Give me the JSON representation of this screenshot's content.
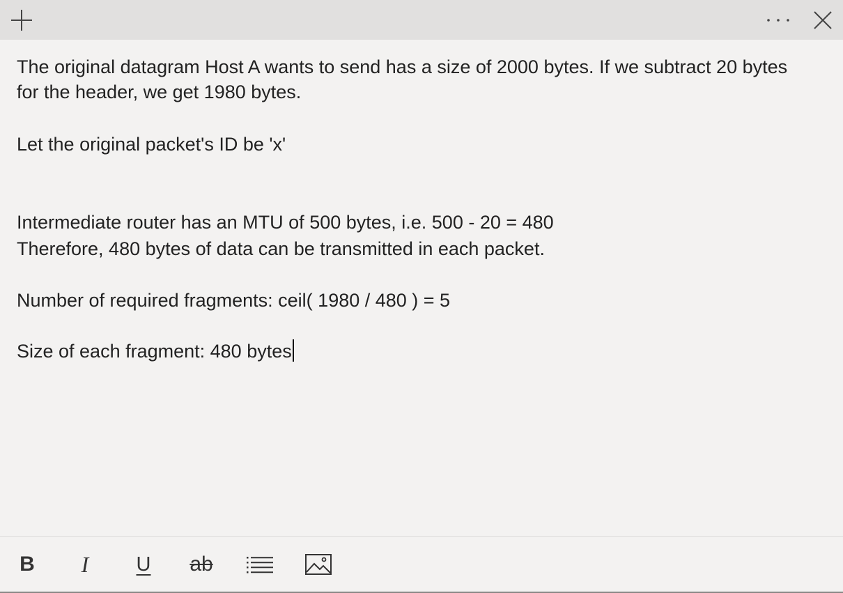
{
  "titlebar": {
    "icons": {
      "add": "plus-icon",
      "more": "more-horizontal-icon",
      "close": "close-icon"
    }
  },
  "note": {
    "lines": [
      "The original datagram Host A wants to send has a size of 2000 bytes. If we subtract 20 bytes",
      "for the header, we get 1980 bytes.",
      "Let the original packet's ID be 'x'",
      "Intermediate router has an MTU of 500 bytes, i.e. 500 - 20 = 480",
      "Therefore, 480 bytes of data can be transmitted in each packet.",
      "Number of required fragments:  ceil( 1980 / 480 ) = 5",
      "Size of each fragment: 480 bytes"
    ]
  },
  "toolbar": {
    "bold_label": "B",
    "italic_label": "I",
    "underline_label": "U",
    "strikethrough_label": "ab",
    "icons": {
      "list": "bulleted-list-icon",
      "image": "image-icon"
    }
  }
}
